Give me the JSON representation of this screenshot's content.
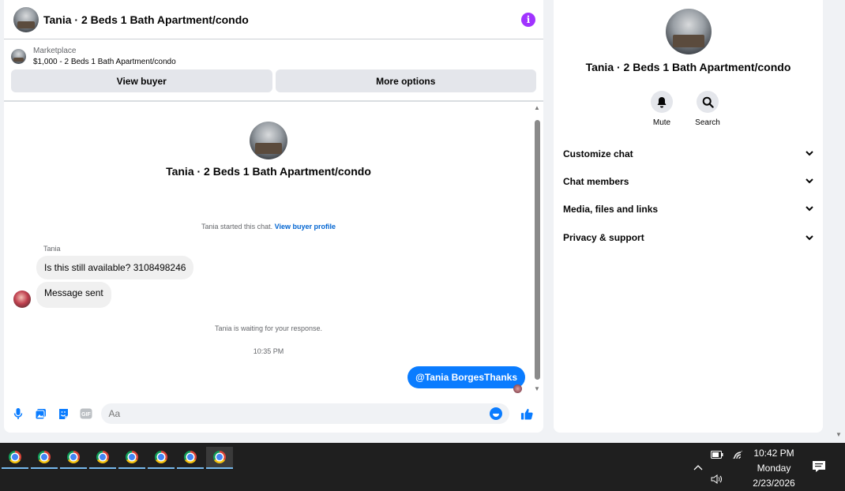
{
  "chat": {
    "header_title": "Tania · 2 Beds 1 Bath Apartment/condo",
    "marketplace_label": "Marketplace",
    "listing": "$1,000 - 2 Beds 1 Bath Apartment/condo",
    "view_buyer": "View buyer",
    "more_options": "More options"
  },
  "thread": {
    "title": "Tania · 2 Beds 1 Bath Apartment/condo",
    "started_text": "Tania started this chat.",
    "view_buyer_profile": "View buyer profile",
    "sender_name": "Tania",
    "message1": "Is this still available? 3108498246",
    "message2": "Message sent",
    "waiting": "Tania is waiting for your response.",
    "time": "10:35 PM",
    "outgoing": "@Tania BorgesThanks"
  },
  "composer": {
    "placeholder": "Aa"
  },
  "info": {
    "title": "Tania · 2 Beds 1 Bath Apartment/condo",
    "mute": "Mute",
    "search": "Search",
    "menu": [
      {
        "label": "Customize chat"
      },
      {
        "label": "Chat members"
      },
      {
        "label": "Media, files and links"
      },
      {
        "label": "Privacy & support"
      }
    ]
  },
  "taskbar": {
    "time": "10:42 PM",
    "day": "Monday",
    "date": "2/23/2026",
    "apps": [
      "chrome",
      "chrome",
      "chrome",
      "chrome",
      "chrome",
      "chrome",
      "chrome",
      "chrome"
    ]
  },
  "colors": {
    "accent": "#0a7cff",
    "info_icon": "#a033ff",
    "link": "#0064d1"
  }
}
